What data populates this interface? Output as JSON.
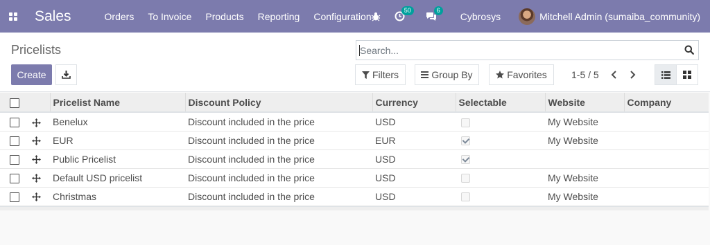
{
  "navbar": {
    "app_name": "Sales",
    "menu": [
      "Orders",
      "To Invoice",
      "Products",
      "Reporting",
      "Configuration"
    ],
    "activity_badge": "50",
    "messages_badge": "6",
    "company": "Cybrosys",
    "user": "Mitchell Admin (sumaiba_community)"
  },
  "control_panel": {
    "breadcrumb": "Pricelists",
    "search_placeholder": "Search...",
    "create_label": "Create",
    "filters_label": "Filters",
    "group_by_label": "Group By",
    "favorites_label": "Favorites",
    "pager": "1-5 / 5"
  },
  "table": {
    "columns": [
      "Pricelist Name",
      "Discount Policy",
      "Currency",
      "Selectable",
      "Website",
      "Company"
    ],
    "rows": [
      {
        "name": "Benelux",
        "policy": "Discount included in the price",
        "currency": "USD",
        "selectable": false,
        "website": "My Website",
        "company": ""
      },
      {
        "name": "EUR",
        "policy": "Discount included in the price",
        "currency": "EUR",
        "selectable": true,
        "website": "My Website",
        "company": ""
      },
      {
        "name": "Public Pricelist",
        "policy": "Discount included in the price",
        "currency": "USD",
        "selectable": true,
        "website": "",
        "company": ""
      },
      {
        "name": "Default USD pricelist",
        "policy": "Discount included in the price",
        "currency": "USD",
        "selectable": false,
        "website": "My Website",
        "company": ""
      },
      {
        "name": "Christmas",
        "policy": "Discount included in the price",
        "currency": "USD",
        "selectable": false,
        "website": "My Website",
        "company": ""
      }
    ]
  },
  "colors": {
    "navbar": "#7c7bad",
    "primary_button": "#7c7bad",
    "badge": "#00a09d"
  }
}
